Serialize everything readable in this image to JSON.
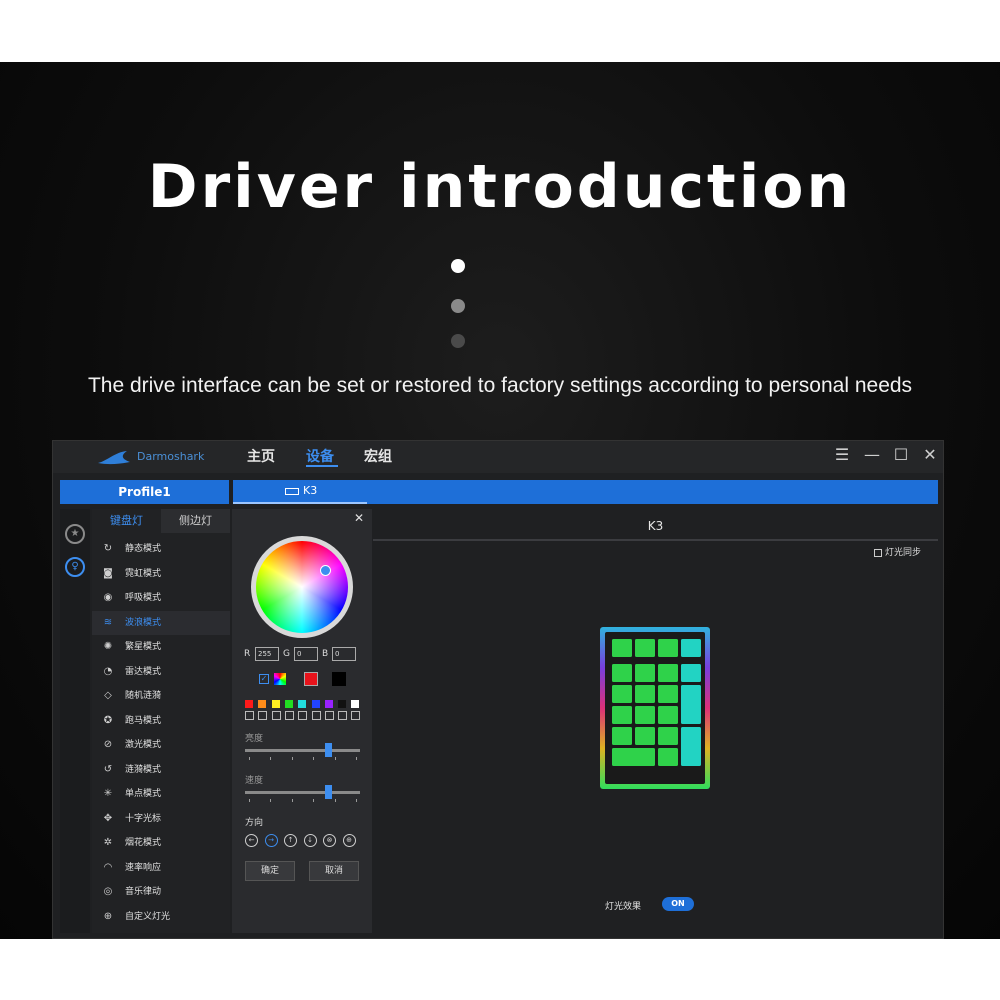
{
  "headline": "Driver introduction",
  "subline": "The drive interface can be set or restored to factory settings according to personal needs",
  "app": {
    "brand": "Darmoshark",
    "nav": [
      "主页",
      "设备",
      "宏组"
    ],
    "nav_active": "设备",
    "window_controls": [
      "☰",
      "—",
      "☐",
      "✕"
    ],
    "profile": "Profile1",
    "device_tab": "K3",
    "tabs": {
      "keyboard_light": "键盘灯",
      "side_light": "侧边灯"
    },
    "modes": [
      {
        "label": "静态模式",
        "icon": "↻"
      },
      {
        "label": "霓虹模式",
        "icon": "◙"
      },
      {
        "label": "呼吸模式",
        "icon": "◉"
      },
      {
        "label": "波浪模式",
        "icon": "≋"
      },
      {
        "label": "繁星模式",
        "icon": "✺"
      },
      {
        "label": "雷达模式",
        "icon": "◔"
      },
      {
        "label": "随机涟漪",
        "icon": "◇"
      },
      {
        "label": "跑马模式",
        "icon": "✪"
      },
      {
        "label": "激光模式",
        "icon": "⊘"
      },
      {
        "label": "涟漪模式",
        "icon": "↺"
      },
      {
        "label": "单点模式",
        "icon": "✳"
      },
      {
        "label": "十字光标",
        "icon": "✥"
      },
      {
        "label": "烟花模式",
        "icon": "✲"
      },
      {
        "label": "速率响应",
        "icon": "◠"
      },
      {
        "label": "音乐律动",
        "icon": "◎"
      },
      {
        "label": "自定义灯光",
        "icon": "⊕"
      }
    ],
    "active_mode": "波浪模式",
    "color": {
      "close": "✕",
      "r_label": "R",
      "g_label": "G",
      "b_label": "B",
      "r": "255",
      "g": "0",
      "b": "0",
      "selected_color": "#e8131b",
      "swatches": [
        "#ff1a1a",
        "#ff8c1a",
        "#ffee22",
        "#22dd22",
        "#22dddd",
        "#2244ff",
        "#9922ff",
        "#111111",
        "#ffffff"
      ],
      "brightness_label": "亮度",
      "brightness": 0.72,
      "speed_label": "速度",
      "speed": 0.72,
      "direction_label": "方向",
      "directions": [
        "←",
        "→",
        "↑",
        "↓",
        "⊗",
        "⊕"
      ],
      "active_direction": 1,
      "confirm": "确定",
      "cancel": "取消"
    },
    "preview": {
      "title": "K3",
      "sync_label": "灯光同步",
      "effect_label": "灯光效果",
      "effect_state": "ON"
    }
  },
  "colors": {
    "accent": "#1e6fd8",
    "accent_text": "#3d8ef0",
    "app_bg": "#1f2022",
    "key_green": "#2fd24a",
    "key_teal": "#22d3c3"
  }
}
